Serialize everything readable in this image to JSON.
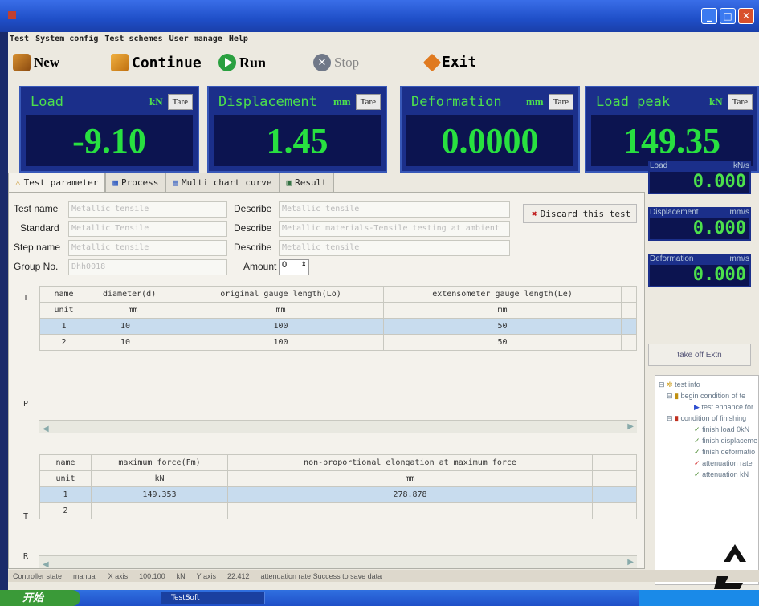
{
  "menu": [
    "Test",
    "System config",
    "Test schemes",
    "User manage",
    "Help"
  ],
  "toolbar": {
    "new": "New",
    "continue": "Continue",
    "run": "Run",
    "stop": "Stop",
    "exit": "Exit"
  },
  "displays": [
    {
      "label": "Load",
      "unit": "kN",
      "tare": "Tare",
      "value": "-9.10"
    },
    {
      "label": "Displacement",
      "unit": "mm",
      "tare": "Tare",
      "value": "1.45"
    },
    {
      "label": "Deformation",
      "unit": "mm",
      "tare": "Tare",
      "value": "0.0000"
    },
    {
      "label": "Load peak",
      "unit": "kN",
      "tare": "Tare",
      "value": "149.35"
    }
  ],
  "tabs": [
    "Test parameter",
    "Process",
    "Multi chart curve",
    "Result"
  ],
  "form": {
    "test_name_label": "Test name",
    "test_name": "Metallic tensile",
    "standard_label": "Standard",
    "standard": "Metallic Tensile",
    "step_name_label": "Step name",
    "step_name": "Metallic tensile",
    "group_no_label": "Group No.",
    "group_no": "Dhh0018",
    "describe_label": "Describe",
    "describe1": "Metallic tensile",
    "describe2": "Metallic materials-Tensile testing at ambient",
    "describe3": "Metallic tensile",
    "amount_label": "Amount",
    "amount": "0",
    "discard": "Discard this test"
  },
  "table1": {
    "side_top": "T",
    "side_mid": "P",
    "headers": [
      "name",
      "diameter(d)",
      "original gauge length(Lo)",
      "extensometer gauge length(Le)"
    ],
    "units": [
      "unit",
      "mm",
      "mm",
      "mm"
    ],
    "rows": [
      [
        "1",
        "10",
        "100",
        "50"
      ],
      [
        "2",
        "10",
        "100",
        "50"
      ]
    ]
  },
  "table2": {
    "side_top": "T",
    "side_bottom": "R",
    "headers": [
      "name",
      "maximum force(Fm)",
      "non-proportional elongation at maximum force"
    ],
    "units": [
      "unit",
      "kN",
      "mm"
    ],
    "rows": [
      [
        "1",
        "149.353",
        "278.878"
      ],
      [
        "2",
        "",
        ""
      ]
    ]
  },
  "rates": [
    {
      "label": "Load",
      "unit": "kN/s",
      "value": "0.000"
    },
    {
      "label": "Displacement",
      "unit": "mm/s",
      "value": "0.000"
    },
    {
      "label": "Deformation",
      "unit": "mm/s",
      "value": "0.000"
    }
  ],
  "take_off": "take off Extn",
  "tree": {
    "root": "test info",
    "begin": "begin condition of te",
    "enhance": "test enhance for",
    "finish": "condition of finishing",
    "items": [
      "finish load 0kN",
      "finish displaceme",
      "finish deformatio",
      "attenuation rate",
      "attenuation kN"
    ]
  },
  "status": [
    "Controller state",
    "manual",
    "X axis",
    "100.100",
    "kN",
    "Y axis",
    "22.412",
    "attenuation rate Success to save data"
  ],
  "taskbar": {
    "start": "开始",
    "task": "TestSoft"
  },
  "colors": {
    "display_bg": "#0c1450",
    "display_text": "#28e040",
    "selection": "#c8dcee"
  }
}
